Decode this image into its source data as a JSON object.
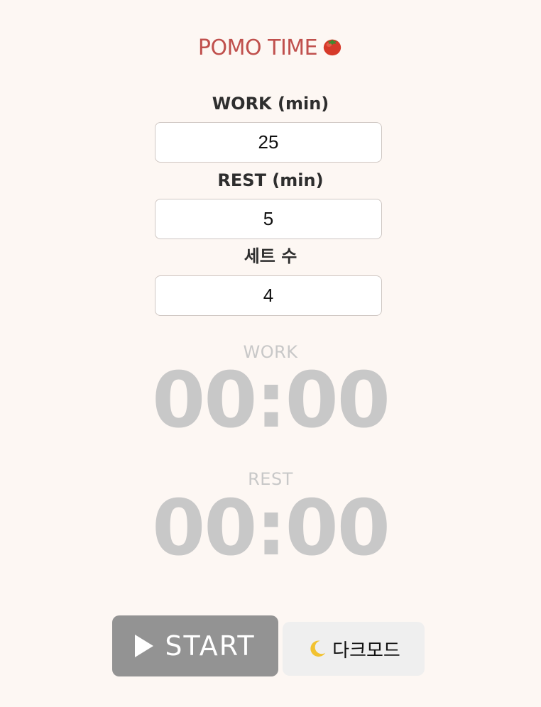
{
  "app": {
    "title": "POMO TIME",
    "title_icon": "tomato-icon"
  },
  "settings": {
    "work": {
      "label": "WORK (min)",
      "value": "25"
    },
    "rest": {
      "label": "REST (min)",
      "value": "5"
    },
    "sets": {
      "label": "세트 수",
      "value": "4"
    }
  },
  "timers": {
    "work": {
      "label": "WORK",
      "value": "00:00"
    },
    "rest": {
      "label": "REST",
      "value": "00:00"
    }
  },
  "controls": {
    "start_label": "START",
    "start_icon": "play-icon",
    "dark_mode_label": "다크모드",
    "dark_mode_icon": "moon-icon"
  },
  "colors": {
    "background": "#fdf7f3",
    "title": "#c0504d",
    "timer_text": "#c8c8c8",
    "start_button": "#939393",
    "dark_mode_button": "#efefef"
  }
}
